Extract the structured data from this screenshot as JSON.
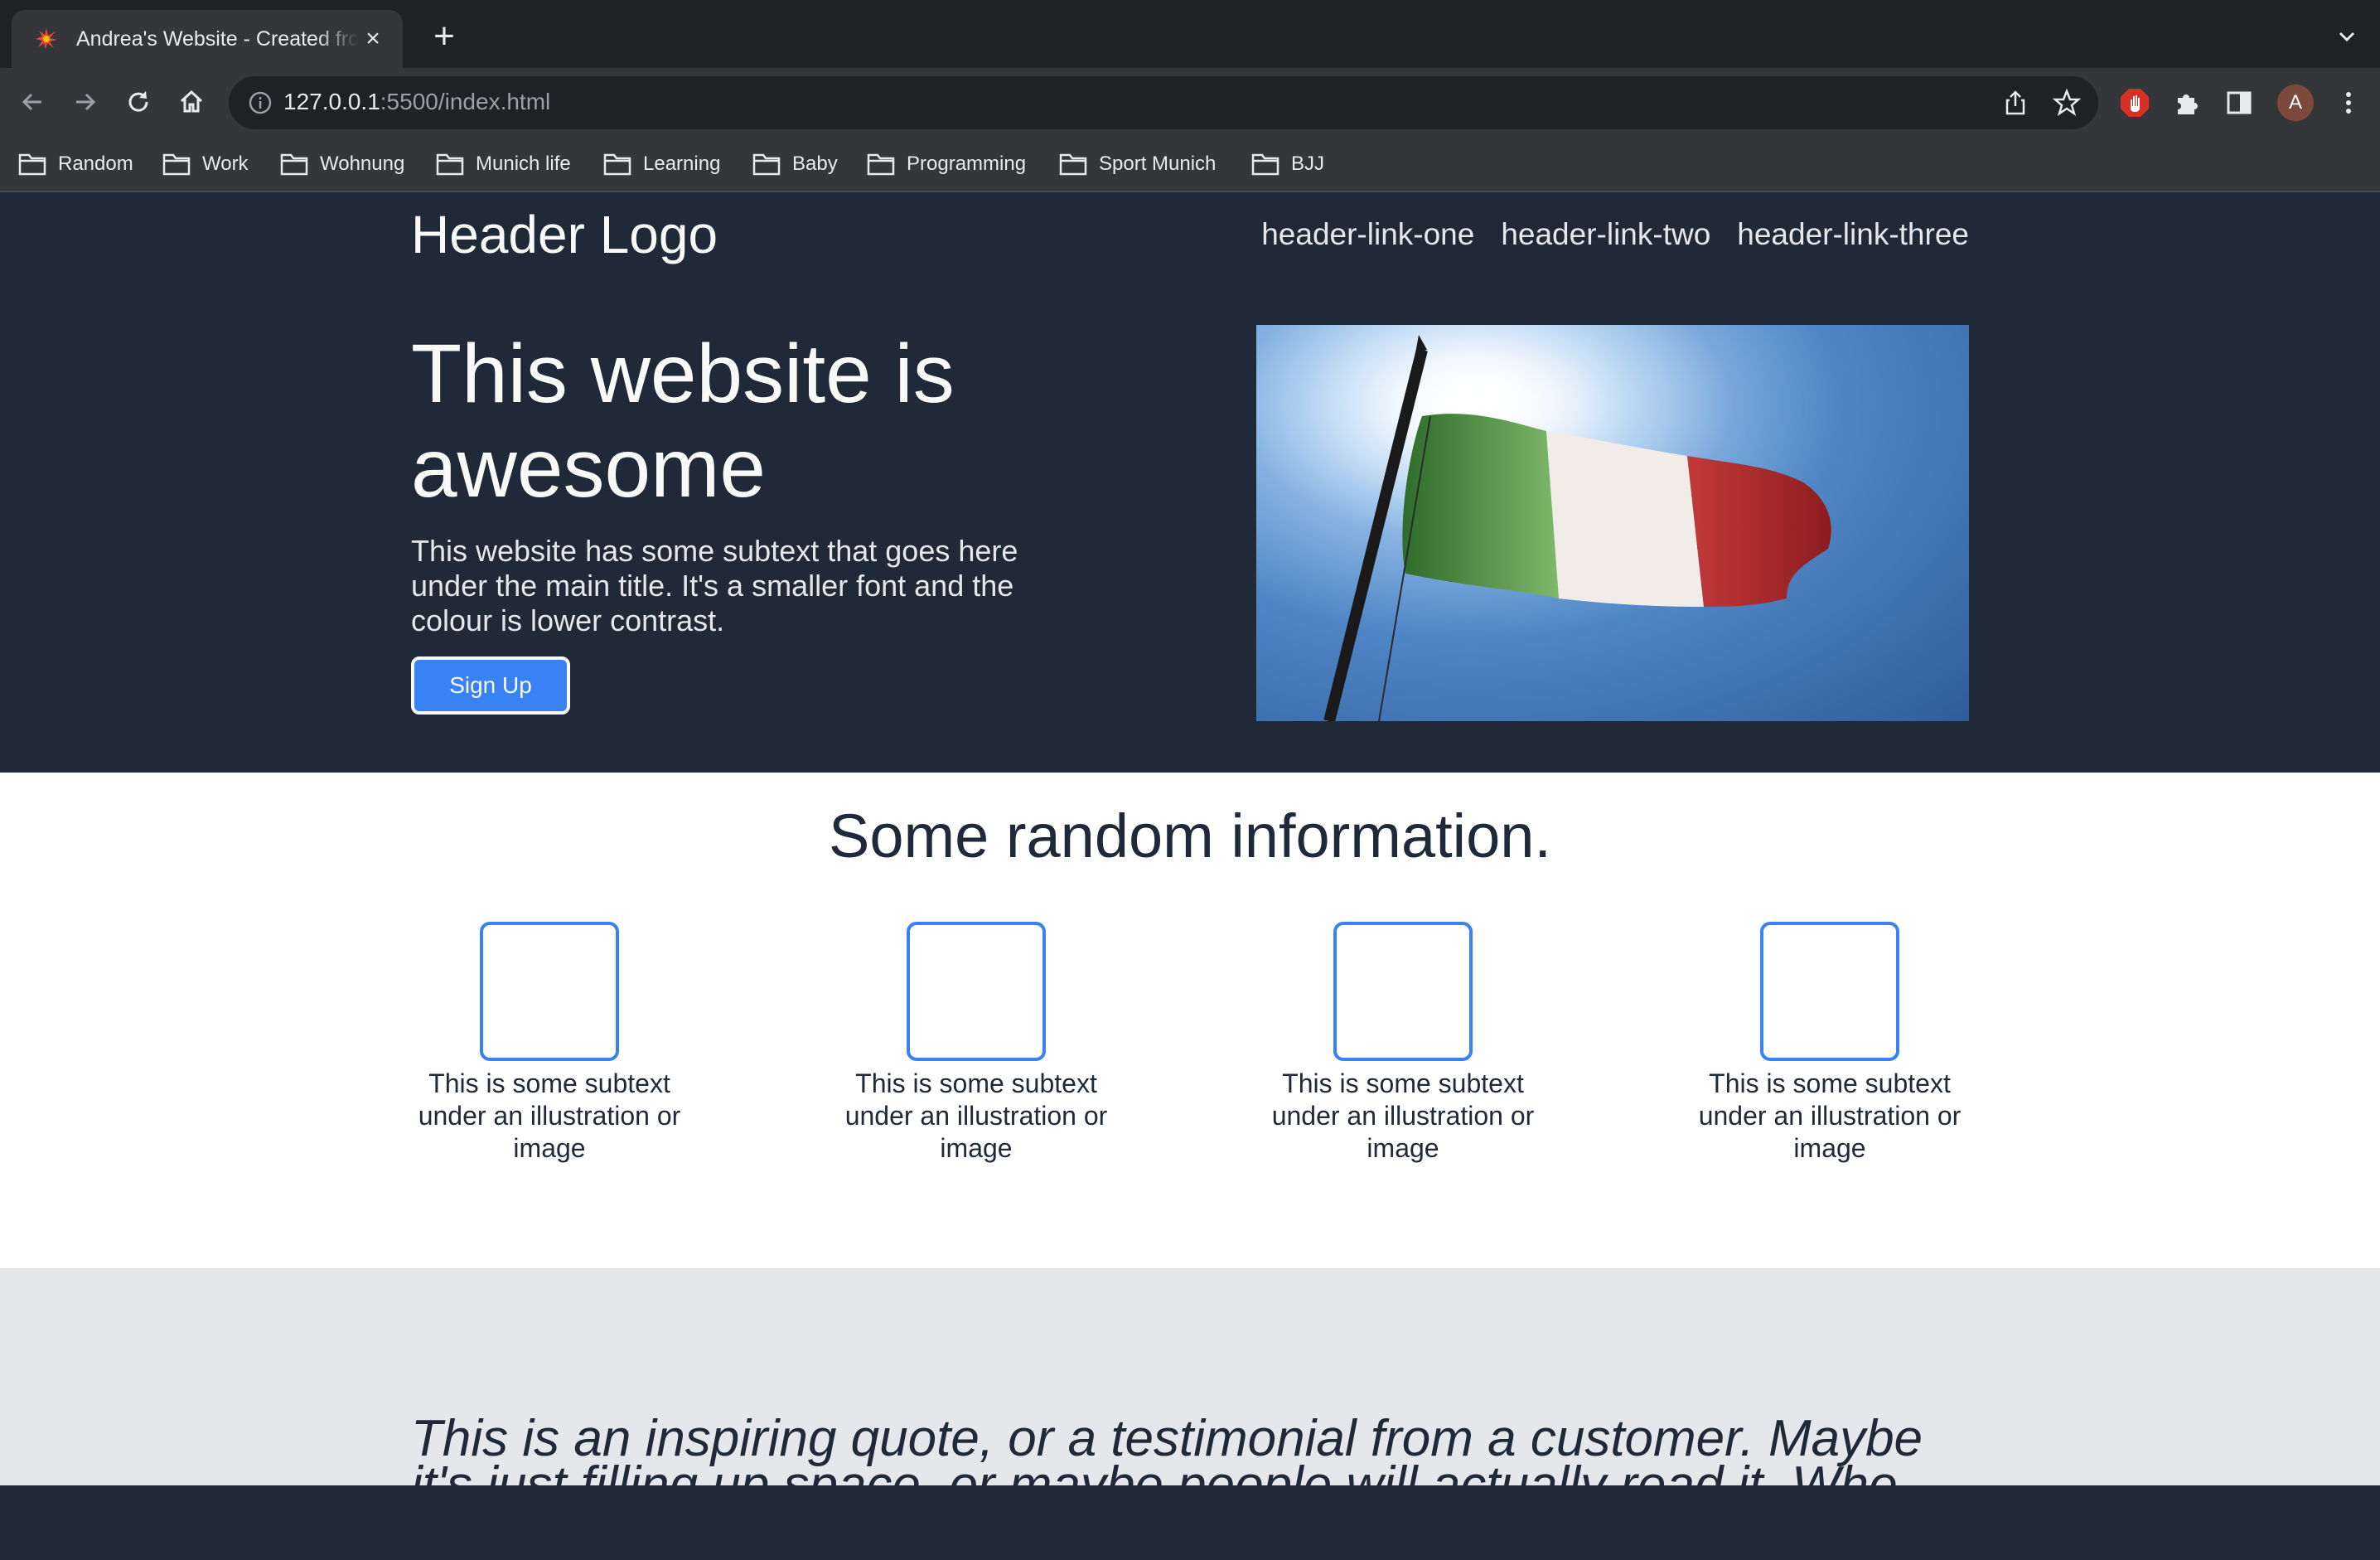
{
  "browser": {
    "tab_title": "Andrea's Website - Created from scratch",
    "new_tab_label": "+",
    "close_label": "×",
    "url_host": "127.0.0.1",
    "url_path": ":5500/index.html",
    "avatar_letter": "A",
    "bookmarks": [
      "Random",
      "Work",
      "Wohnung",
      "Munich life",
      "Learning",
      "Baby",
      "Programming",
      "Sport Munich",
      "BJJ"
    ]
  },
  "header": {
    "logo": "Header Logo",
    "links": [
      "header-link-one",
      "header-link-two",
      "header-link-three"
    ]
  },
  "hero": {
    "title": "This website is awesome",
    "subtitle": "This website has some subtext that goes here under the main title. It's a smaller font and the colour is lower contrast.",
    "button_label": "Sign Up",
    "image": "italian-flag-photo"
  },
  "info": {
    "title": "Some random information.",
    "cards": [
      "This is some subtext under an illustration or image",
      "This is some subtext under an illustration or image",
      "This is some subtext under an illustration or image",
      "This is some subtext under an illustration or image"
    ]
  },
  "quote": {
    "text": "This is an inspiring quote, or a testimonial from a customer. Maybe it's just filling up space, or maybe people will actually read it. Who knows? All"
  },
  "colors": {
    "hero_bg": "#1f2937",
    "accent": "#3882f6",
    "quote_bg": "#e5e7eb",
    "text_light": "#f9faf8"
  }
}
